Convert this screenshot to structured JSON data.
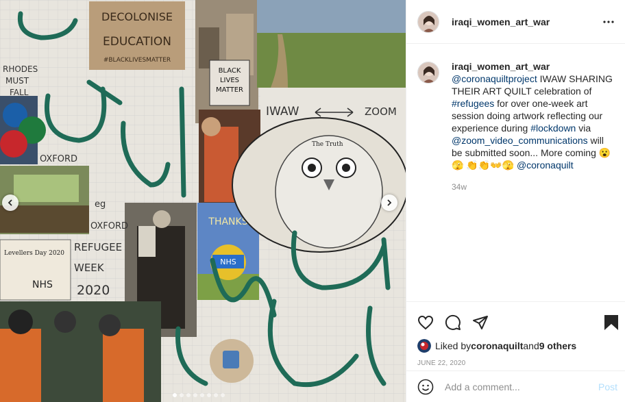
{
  "post": {
    "username": "iraqi_women_art_war",
    "caption": {
      "mention_project": "@coronaquiltproject",
      "text_1": " IWAW SHARING THEIR ART QUILT celebration of ",
      "hashtag_refugees": "#refugees",
      "text_2": " for over one-week art session doing artwork reflecting our experience during ",
      "hashtag_lockdown": "#lockdown",
      "text_3": " via ",
      "mention_zoom": "@zoom_video_communications",
      "text_4": " will be submitted soon... More coming 😮🫣 👏👏👐🫣 ",
      "mention_quilt": "@coronaquilt"
    },
    "time_ago": "34w",
    "likes": {
      "prefix": "Liked by ",
      "user": "coronaquilt",
      "conjunction": " and ",
      "others": "9 others"
    },
    "date": "JUNE 22, 2020"
  },
  "comment_box": {
    "placeholder": "Add a comment...",
    "post_label": "Post"
  },
  "collage_text": {
    "sign_1": "DECOLONISE",
    "sign_2": "EDUCATION",
    "sign_3": "#BLACKLIVESMATTER",
    "blm_1": "BLACK",
    "blm_2": "LIVES",
    "blm_3": "MATTER",
    "rhodes_1": "RHODES",
    "rhodes_2": "MUST",
    "rhodes_3": "FALL",
    "oxford_1": "OXFORD",
    "eg": "eg",
    "oxford_2": "OXFORD",
    "iwaw": "IWAW",
    "zoom": "ZOOM",
    "owl": "The Truth",
    "thanks": "THANKS",
    "nhs": "NHS",
    "refugee_1": "REFUGEE",
    "refugee_2": "WEEK",
    "refugee_3": "2020",
    "levellers": "Levellers Day 2020",
    "nhs_small": "NHS"
  },
  "carousel": {
    "count": 8,
    "active": 0
  },
  "colors": {
    "link": "#00376b",
    "meta": "#8e8e8e",
    "post": "#b2dffc",
    "ink": "#1f6b57"
  },
  "icons": [
    "more-icon",
    "chevron-left-icon",
    "chevron-right-icon",
    "heart-icon",
    "comment-icon",
    "share-icon",
    "bookmark-icon",
    "emoji-icon"
  ]
}
